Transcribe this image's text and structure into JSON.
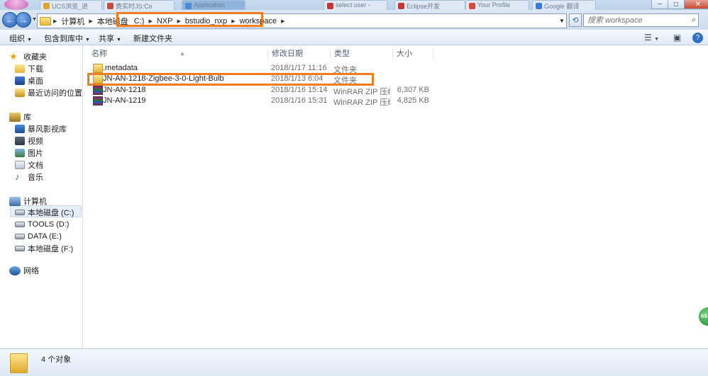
{
  "browser_tabs": [
    {
      "label": "UCS浏览_进",
      "color": "#e3a33b"
    },
    {
      "label": "费实时JS:Co",
      "color": "#c94a3a"
    },
    {
      "label": "Application",
      "color": "#4a8bd6"
    },
    {
      "label": "select user -",
      "color": "#c43535"
    },
    {
      "label": "Eclipse开发",
      "color": "#c43535"
    },
    {
      "label": "Your Profile",
      "color": "#d94a3c"
    },
    {
      "label": "Google 翻译",
      "color": "#3b7be0"
    }
  ],
  "address": {
    "crumbs": [
      "计算机",
      "本地磁盘",
      "C:)",
      "NXP",
      "bstudio_nxp",
      "workspace"
    ]
  },
  "search": {
    "placeholder": "搜索 workspace"
  },
  "toolbar": {
    "organize": "组织",
    "include_in_library": "包含到库中",
    "share": "共享",
    "new_folder": "新建文件夹"
  },
  "nav": {
    "favorites": {
      "title": "收藏夹",
      "items": [
        "下载",
        "桌面",
        "最近访问的位置"
      ]
    },
    "libraries": {
      "title": "库",
      "items": [
        "暴风影视库",
        "视频",
        "图片",
        "文档",
        "音乐"
      ]
    },
    "computer": {
      "title": "计算机",
      "items": [
        "本地磁盘 (C:)",
        "TOOLS (D:)",
        "DATA (E:)",
        "本地磁盘 (F:)"
      ]
    },
    "network": {
      "title": "网络"
    }
  },
  "columns": {
    "name": "名称",
    "modified": "修改日期",
    "type": "类型",
    "size": "大小"
  },
  "files": [
    {
      "name": ".metadata",
      "modified": "2018/1/17 11:16",
      "type": "文件夹",
      "size": "",
      "icon": "folder-icon"
    },
    {
      "name": "JN-AN-1218-Zigbee-3-0-Light-Bulb",
      "modified": "2018/1/13 6:04",
      "type": "文件夹",
      "size": "",
      "icon": "folder-icon"
    },
    {
      "name": "JN-AN-1218",
      "modified": "2018/1/16 15:14",
      "type": "WinRAR ZIP 压缩...",
      "size": "6,307 KB",
      "icon": "zip-archive-icon"
    },
    {
      "name": "JN-AN-1219",
      "modified": "2018/1/16 15:31",
      "type": "WinRAR ZIP 压缩...",
      "size": "4,825 KB",
      "icon": "zip-archive-icon"
    }
  ],
  "status": {
    "count_text": "4 个对象"
  },
  "badge": {
    "text": "66"
  },
  "colors": {
    "highlight": "#ef7d22",
    "address_bg": "#cddcee"
  }
}
